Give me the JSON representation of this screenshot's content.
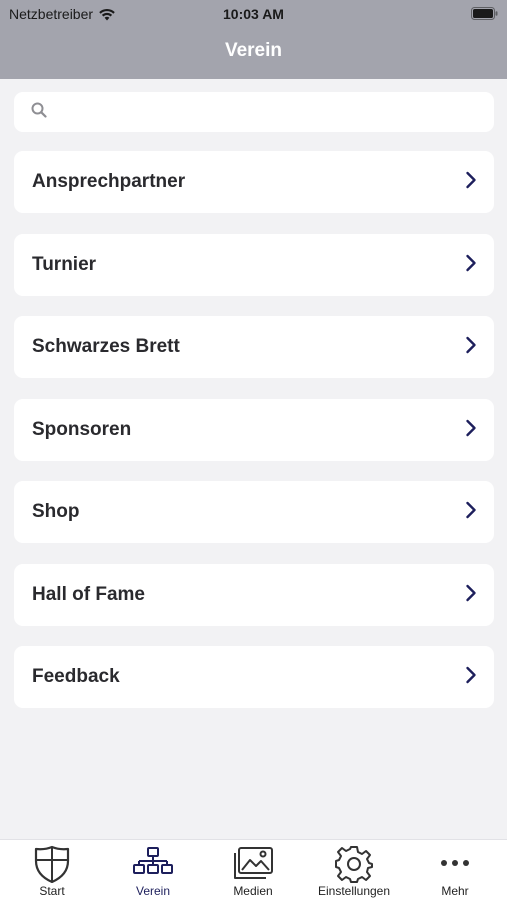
{
  "status_bar": {
    "carrier": "Netzbetreiber",
    "time": "10:03 AM"
  },
  "nav": {
    "title": "Verein"
  },
  "search": {
    "placeholder": "",
    "value": ""
  },
  "menu": {
    "items": [
      {
        "label": "Ansprechpartner"
      },
      {
        "label": "Turnier"
      },
      {
        "label": "Schwarzes Brett"
      },
      {
        "label": "Sponsoren"
      },
      {
        "label": "Shop"
      },
      {
        "label": "Hall of Fame"
      },
      {
        "label": "Feedback"
      }
    ]
  },
  "tabbar": {
    "tabs": [
      {
        "label": "Start",
        "icon": "shield-icon"
      },
      {
        "label": "Verein",
        "icon": "org-chart-icon",
        "active": true
      },
      {
        "label": "Medien",
        "icon": "images-icon"
      },
      {
        "label": "Einstellungen",
        "icon": "gear-icon"
      },
      {
        "label": "Mehr",
        "icon": "more-icon"
      }
    ]
  },
  "colors": {
    "header_bg": "#a3a4ad",
    "page_bg": "#f2f2f4",
    "accent": "#1d1f5c",
    "chevron": "#1d1f5c"
  }
}
